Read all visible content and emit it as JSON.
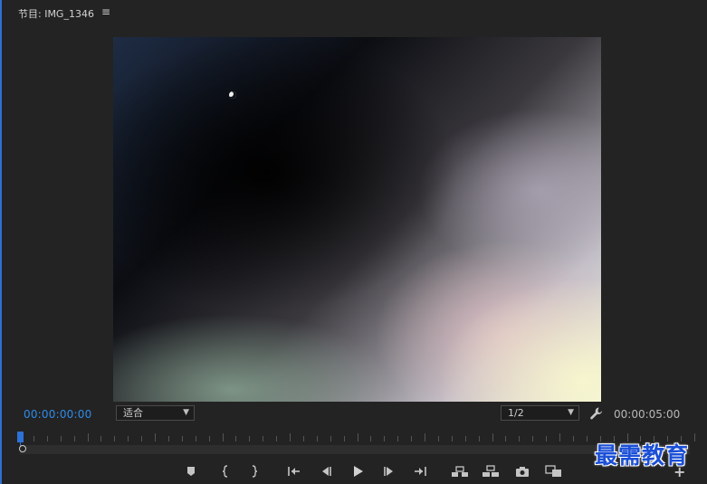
{
  "panel": {
    "title": "节目: IMG_1346",
    "menu_icon": "≡"
  },
  "timecodes": {
    "current": "00:00:00:00",
    "duration": "00:00:05:00"
  },
  "zoom": {
    "selected": "适合"
  },
  "resolution": {
    "selected": "1/2"
  },
  "playback_progress": 0,
  "transport": [
    {
      "name": "marker-icon"
    },
    {
      "name": "mark-in-icon"
    },
    {
      "name": "mark-out-icon"
    },
    {
      "name": "go-to-in-icon"
    },
    {
      "name": "step-back-icon"
    },
    {
      "name": "play-icon"
    },
    {
      "name": "step-forward-icon"
    },
    {
      "name": "go-to-out-icon"
    },
    {
      "name": "lift-icon"
    },
    {
      "name": "extract-icon"
    },
    {
      "name": "export-frame-icon"
    },
    {
      "name": "comparison-view-icon"
    }
  ],
  "add_button": "+",
  "watermark": "最需教育",
  "colors": {
    "accent": "#2d8ceb",
    "background": "#232323",
    "playhead": "#2d72d6"
  }
}
